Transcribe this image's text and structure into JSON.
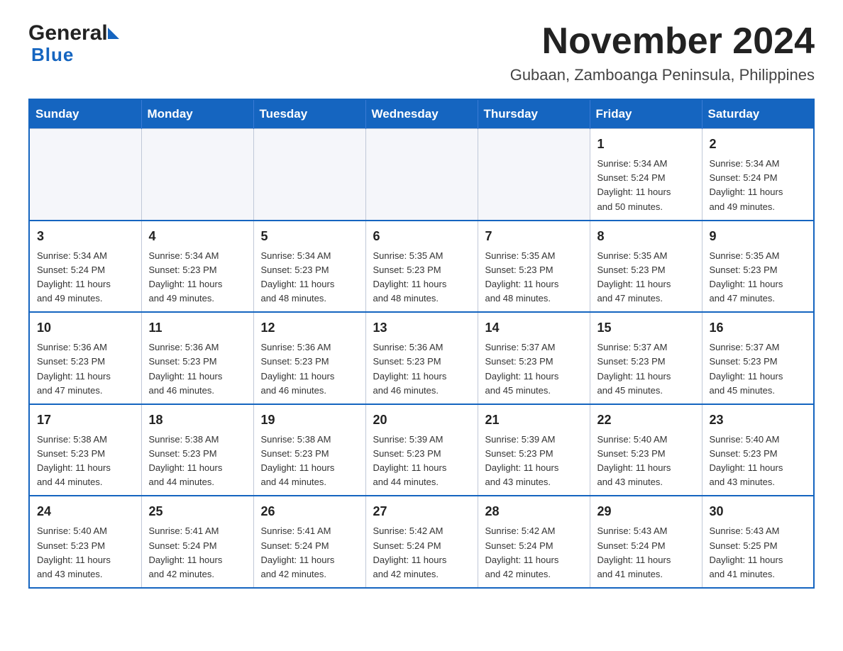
{
  "header": {
    "month_title": "November 2024",
    "location": "Gubaan, Zamboanga Peninsula, Philippines",
    "logo_general": "General",
    "logo_blue": "Blue"
  },
  "weekdays": [
    "Sunday",
    "Monday",
    "Tuesday",
    "Wednesday",
    "Thursday",
    "Friday",
    "Saturday"
  ],
  "weeks": [
    [
      {
        "day": "",
        "info": ""
      },
      {
        "day": "",
        "info": ""
      },
      {
        "day": "",
        "info": ""
      },
      {
        "day": "",
        "info": ""
      },
      {
        "day": "",
        "info": ""
      },
      {
        "day": "1",
        "info": "Sunrise: 5:34 AM\nSunset: 5:24 PM\nDaylight: 11 hours\nand 50 minutes."
      },
      {
        "day": "2",
        "info": "Sunrise: 5:34 AM\nSunset: 5:24 PM\nDaylight: 11 hours\nand 49 minutes."
      }
    ],
    [
      {
        "day": "3",
        "info": "Sunrise: 5:34 AM\nSunset: 5:24 PM\nDaylight: 11 hours\nand 49 minutes."
      },
      {
        "day": "4",
        "info": "Sunrise: 5:34 AM\nSunset: 5:23 PM\nDaylight: 11 hours\nand 49 minutes."
      },
      {
        "day": "5",
        "info": "Sunrise: 5:34 AM\nSunset: 5:23 PM\nDaylight: 11 hours\nand 48 minutes."
      },
      {
        "day": "6",
        "info": "Sunrise: 5:35 AM\nSunset: 5:23 PM\nDaylight: 11 hours\nand 48 minutes."
      },
      {
        "day": "7",
        "info": "Sunrise: 5:35 AM\nSunset: 5:23 PM\nDaylight: 11 hours\nand 48 minutes."
      },
      {
        "day": "8",
        "info": "Sunrise: 5:35 AM\nSunset: 5:23 PM\nDaylight: 11 hours\nand 47 minutes."
      },
      {
        "day": "9",
        "info": "Sunrise: 5:35 AM\nSunset: 5:23 PM\nDaylight: 11 hours\nand 47 minutes."
      }
    ],
    [
      {
        "day": "10",
        "info": "Sunrise: 5:36 AM\nSunset: 5:23 PM\nDaylight: 11 hours\nand 47 minutes."
      },
      {
        "day": "11",
        "info": "Sunrise: 5:36 AM\nSunset: 5:23 PM\nDaylight: 11 hours\nand 46 minutes."
      },
      {
        "day": "12",
        "info": "Sunrise: 5:36 AM\nSunset: 5:23 PM\nDaylight: 11 hours\nand 46 minutes."
      },
      {
        "day": "13",
        "info": "Sunrise: 5:36 AM\nSunset: 5:23 PM\nDaylight: 11 hours\nand 46 minutes."
      },
      {
        "day": "14",
        "info": "Sunrise: 5:37 AM\nSunset: 5:23 PM\nDaylight: 11 hours\nand 45 minutes."
      },
      {
        "day": "15",
        "info": "Sunrise: 5:37 AM\nSunset: 5:23 PM\nDaylight: 11 hours\nand 45 minutes."
      },
      {
        "day": "16",
        "info": "Sunrise: 5:37 AM\nSunset: 5:23 PM\nDaylight: 11 hours\nand 45 minutes."
      }
    ],
    [
      {
        "day": "17",
        "info": "Sunrise: 5:38 AM\nSunset: 5:23 PM\nDaylight: 11 hours\nand 44 minutes."
      },
      {
        "day": "18",
        "info": "Sunrise: 5:38 AM\nSunset: 5:23 PM\nDaylight: 11 hours\nand 44 minutes."
      },
      {
        "day": "19",
        "info": "Sunrise: 5:38 AM\nSunset: 5:23 PM\nDaylight: 11 hours\nand 44 minutes."
      },
      {
        "day": "20",
        "info": "Sunrise: 5:39 AM\nSunset: 5:23 PM\nDaylight: 11 hours\nand 44 minutes."
      },
      {
        "day": "21",
        "info": "Sunrise: 5:39 AM\nSunset: 5:23 PM\nDaylight: 11 hours\nand 43 minutes."
      },
      {
        "day": "22",
        "info": "Sunrise: 5:40 AM\nSunset: 5:23 PM\nDaylight: 11 hours\nand 43 minutes."
      },
      {
        "day": "23",
        "info": "Sunrise: 5:40 AM\nSunset: 5:23 PM\nDaylight: 11 hours\nand 43 minutes."
      }
    ],
    [
      {
        "day": "24",
        "info": "Sunrise: 5:40 AM\nSunset: 5:23 PM\nDaylight: 11 hours\nand 43 minutes."
      },
      {
        "day": "25",
        "info": "Sunrise: 5:41 AM\nSunset: 5:24 PM\nDaylight: 11 hours\nand 42 minutes."
      },
      {
        "day": "26",
        "info": "Sunrise: 5:41 AM\nSunset: 5:24 PM\nDaylight: 11 hours\nand 42 minutes."
      },
      {
        "day": "27",
        "info": "Sunrise: 5:42 AM\nSunset: 5:24 PM\nDaylight: 11 hours\nand 42 minutes."
      },
      {
        "day": "28",
        "info": "Sunrise: 5:42 AM\nSunset: 5:24 PM\nDaylight: 11 hours\nand 42 minutes."
      },
      {
        "day": "29",
        "info": "Sunrise: 5:43 AM\nSunset: 5:24 PM\nDaylight: 11 hours\nand 41 minutes."
      },
      {
        "day": "30",
        "info": "Sunrise: 5:43 AM\nSunset: 5:25 PM\nDaylight: 11 hours\nand 41 minutes."
      }
    ]
  ]
}
